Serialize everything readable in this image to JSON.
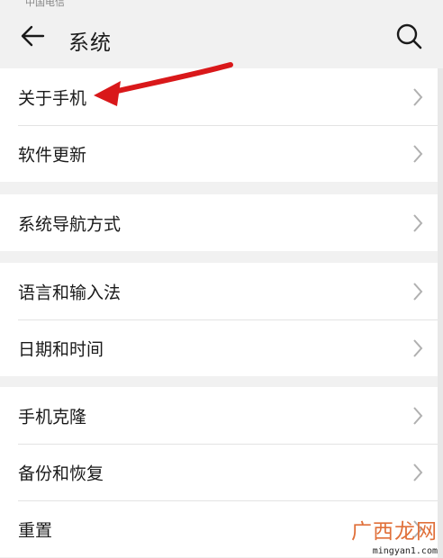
{
  "status_bar": {
    "carrier": "中国电信"
  },
  "header": {
    "title": "系统"
  },
  "groups": [
    {
      "items": [
        {
          "label": "关于手机"
        },
        {
          "label": "软件更新"
        }
      ]
    },
    {
      "items": [
        {
          "label": "系统导航方式"
        }
      ]
    },
    {
      "items": [
        {
          "label": "语言和输入法"
        },
        {
          "label": "日期和时间"
        }
      ]
    },
    {
      "items": [
        {
          "label": "手机克隆"
        },
        {
          "label": "备份和恢复"
        },
        {
          "label": "重置"
        }
      ]
    }
  ],
  "icons": {
    "back": "arrow-left-icon",
    "search": "search-icon",
    "chevron": "chevron-right-icon"
  },
  "colors": {
    "accent": "#e0703a",
    "annotation": "#d9181a"
  },
  "watermark": {
    "text": "广西龙网",
    "url": "mingyan1.com"
  }
}
